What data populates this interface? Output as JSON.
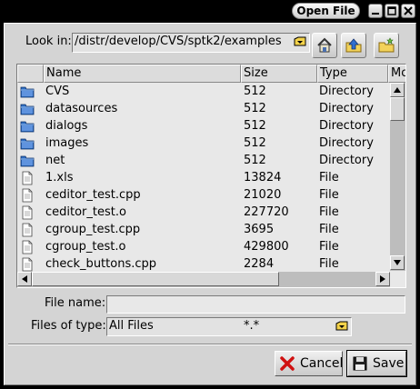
{
  "window": {
    "title": "Open File"
  },
  "look_in": {
    "label": "Look in:",
    "path": "/distr/develop/CVS/sptk2/examples"
  },
  "toolbar": {
    "home": "home-icon",
    "up": "folder-up-icon",
    "new_folder": "new-folder-icon"
  },
  "columns": [
    "Name",
    "Size",
    "Type",
    "Mo"
  ],
  "files": [
    {
      "name": "CVS",
      "size": "512",
      "type": "Directory",
      "icon": "folder-icon"
    },
    {
      "name": "datasources",
      "size": "512",
      "type": "Directory",
      "icon": "folder-icon"
    },
    {
      "name": "dialogs",
      "size": "512",
      "type": "Directory",
      "icon": "folder-icon"
    },
    {
      "name": "images",
      "size": "512",
      "type": "Directory",
      "icon": "folder-icon"
    },
    {
      "name": "net",
      "size": "512",
      "type": "Directory",
      "icon": "folder-icon"
    },
    {
      "name": "1.xls",
      "size": "13824",
      "type": "File",
      "icon": "file-icon"
    },
    {
      "name": "ceditor_test.cpp",
      "size": "21020",
      "type": "File",
      "icon": "file-icon"
    },
    {
      "name": "ceditor_test.o",
      "size": "227720",
      "type": "File",
      "icon": "file-icon"
    },
    {
      "name": "cgroup_test.cpp",
      "size": "3695",
      "type": "File",
      "icon": "file-icon"
    },
    {
      "name": "cgroup_test.o",
      "size": "429800",
      "type": "File",
      "icon": "file-icon"
    },
    {
      "name": "check_buttons.cpp",
      "size": "2284",
      "type": "File",
      "icon": "file-icon"
    }
  ],
  "file_name": {
    "label": "File name:",
    "value": ""
  },
  "file_type": {
    "label": "Files of type:",
    "name": "All Files",
    "pattern": "*.*"
  },
  "buttons": {
    "cancel": "Cancel",
    "save": "Save"
  },
  "colors": {
    "titlebar": "#000000",
    "dialog": "#d4d4d4",
    "list": "#e8e8e8",
    "folder": "#2f6fc4",
    "cancel_x": "#d01010"
  }
}
